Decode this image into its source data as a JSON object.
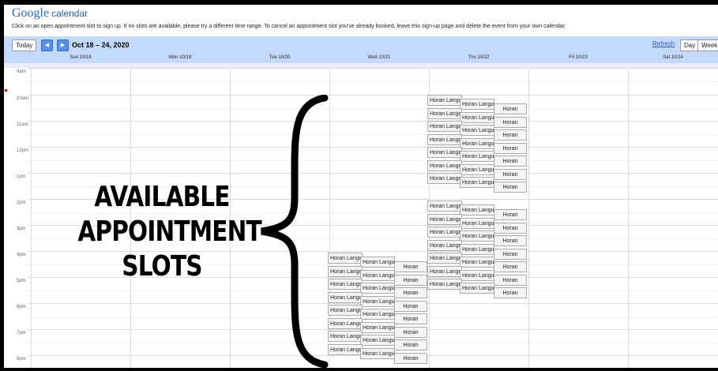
{
  "header": {
    "logo": "Google",
    "product": "calendar",
    "instructions": "Click on an open appointment slot to sign up. If no slots are available, please try a different time range. To cancel an appointment slot you've already booked, leave this sign-up page and delete the event from your own calendar."
  },
  "toolbar": {
    "today_label": "Today",
    "prev_icon": "◀",
    "next_icon": "▶",
    "date_range": "Oct 18 – 24, 2020",
    "refresh_label": "Refresh",
    "day_label": "Day",
    "week_label": "Week"
  },
  "days": [
    "Sun 10/18",
    "Mon 10/19",
    "Tue 10/20",
    "Wed 10/21",
    "Thu 10/22",
    "Fri 10/23",
    "Sat 10/24"
  ],
  "hours": [
    "9am",
    "10am",
    "11am",
    "12pm",
    "1pm",
    "2pm",
    "3pm",
    "4pm",
    "5pm",
    "6pm",
    "7pm",
    "8pm"
  ],
  "slot_labels": {
    "full": "Horan Langu",
    "short": "Horan"
  },
  "annotation": {
    "line1": "AVAILABLE",
    "line2": "APPOINTMENT",
    "line3": "SLOTS"
  },
  "colors": {
    "toolbar_bg": "#c3d9ff",
    "nav_button": "#5b8fe0",
    "link": "#2a5db0",
    "slot_bg": "#f4f4f4"
  }
}
